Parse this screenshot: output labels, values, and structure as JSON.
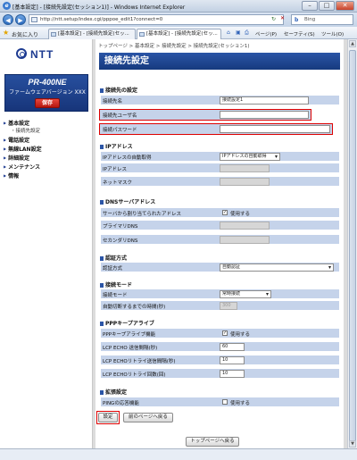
{
  "window": {
    "title": "[基本設定] - [接続先設定(セッション1)] - Windows Internet Explorer",
    "url": "http://ntt.setup/index.cgi/pppoe_edit1?connect=0",
    "search_placeholder": "Bing",
    "favorites_label": "お気に入り",
    "tabs": [
      "[基本設定] - [接続先設定(セッ...",
      "[基本設定] - [接続先設定(セッ..."
    ],
    "toolbar_items": [
      "ページ(P)",
      "セーフティ(S)",
      "ツール(O)"
    ]
  },
  "sidebar": {
    "logo": "NTT",
    "model": "PR-400NE",
    "firmware": "ファームウェアバージョン XXX",
    "save_label": "保存",
    "items": [
      "基本設定",
      "電話設定",
      "無線LAN設定",
      "詳細設定",
      "メンテナンス",
      "情報"
    ],
    "sub_items": [
      "接続先設定"
    ]
  },
  "main": {
    "breadcrumb": "トップページ > 基本設定 > 接続先設定 > 接続先設定(セッション1)",
    "title": "接続先設定",
    "sections": {
      "connection": "接続先の設定",
      "ip": "IPアドレス",
      "dns": "DNSサーバアドレス",
      "auth": "認証方式",
      "mode": "接続モード",
      "ppp": "PPPキープアライブ",
      "ext": "拡張設定"
    },
    "fields": {
      "conn_name_label": "接続先名",
      "conn_name_value": "接続設定1",
      "user_label": "接続先ユーザ名",
      "user_value": "",
      "pass_label": "接続パスワード",
      "pass_value": "",
      "ip_auto_label": "IPアドレスの自動取得",
      "ip_auto_value": "IPアドレスの自動取得",
      "ip_label": "IPアドレス",
      "mask_label": "ネットマスク",
      "dns_auto_label": "サーバから割り当てられたアドレス",
      "use_label": "使用する",
      "dns1_label": "プライマリDNS",
      "dns2_label": "セカンダリDNS",
      "auth_label": "認証方式",
      "auth_value": "自動認証",
      "mode_label": "接続モード",
      "mode_value": "常時接続",
      "disconnect_label": "自動切断するまでの時間(秒)",
      "disconnect_value": "300",
      "keepalive_label": "PPPキープアライブ機能",
      "echo_interval_label": "LCP ECHO 送信間隔(秒)",
      "echo_interval_value": "60",
      "echo_retry_interval_label": "LCP ECHOリトライ送信間隔(秒)",
      "echo_retry_interval_value": "10",
      "echo_retry_count_label": "LCP ECHOリトライ回数(回)",
      "echo_retry_count_value": "10",
      "ping_label": "PINGの応答機能"
    },
    "buttons": {
      "set": "設定",
      "back": "前のページへ戻る",
      "top": "トップページへ戻る"
    }
  }
}
